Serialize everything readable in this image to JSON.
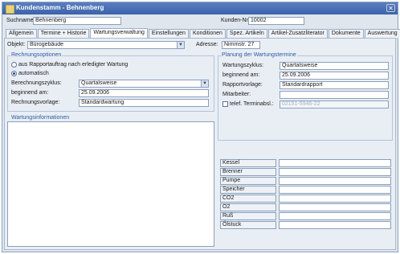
{
  "window": {
    "title": "Kundenstamm - Behnenberg",
    "close_glyph": "✕"
  },
  "header": {
    "suchname_label": "Suchname:",
    "suchname_value": "Behnenberg",
    "kundennr_label": "Kunden-Nr:",
    "kundennr_value": "10002"
  },
  "tabs": [
    {
      "label": "Allgemein"
    },
    {
      "label": "Termine + Historie"
    },
    {
      "label": "Wartungsverwaltung"
    },
    {
      "label": "Einstellungen"
    },
    {
      "label": "Konditionen"
    },
    {
      "label": "Spez. Artikeln"
    },
    {
      "label": "Artikel-Zusatzliterator"
    },
    {
      "label": "Dokumente"
    },
    {
      "label": "Auswertung"
    }
  ],
  "objekt": {
    "label": "Objekt:",
    "value": "Bürogebäude",
    "dropdown_glyph": "▼",
    "adresse_label": "Adresse:",
    "adresse_value": "Nimmstr. 27"
  },
  "rechnungsoptionen": {
    "title": "Rechnungsoptionen",
    "radio1": "aus Rapportauftrag nach erledigter Wartung",
    "radio2": "automatisch",
    "zyklus_label": "Berechnungszyklus:",
    "zyklus_value": "Quartalsweise",
    "beginn_label": "beginnend am:",
    "beginn_value": "25.09.2006",
    "vorlage_label": "Rechnungsvorlage:",
    "vorlage_value": "Standardwartung"
  },
  "planung": {
    "title": "Planung der Wartungstermine",
    "zyklus_label": "Wartungszyklus:",
    "zyklus_value": "Quartalsweise",
    "beginn_label": "beginnend am:",
    "beginn_value": "25.09.2006",
    "vorlage_label": "Rapportvorlage:",
    "vorlage_value": "Standardrapport",
    "mitarbeiter_label": "Mitarbeiter:",
    "mitarbeiter_value": "",
    "telef_label": "telef. Terminabsl.:",
    "telef_value": "02151-5946-22"
  },
  "wartungsinfo": {
    "title": "Wartungsinformationen"
  },
  "measurements": [
    {
      "label": "Kessel"
    },
    {
      "label": "Brenner"
    },
    {
      "label": "Pumpe"
    },
    {
      "label": "Speicher"
    },
    {
      "label": "CO2"
    },
    {
      "label": "O2"
    },
    {
      "label": "Ruß"
    },
    {
      "label": "Ölstuck"
    }
  ]
}
